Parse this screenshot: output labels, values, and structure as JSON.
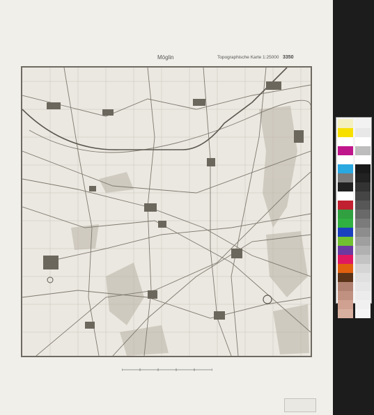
{
  "sheet": {
    "place_name": "Möglin",
    "map_type": "Topographische Karte 1:25000",
    "sheet_number": "3350"
  },
  "colors": {
    "paper": "#f0efea",
    "map_background": "#ebe8e1",
    "map_lines": "#8a857b",
    "frame": "#6e6a62"
  },
  "color_bar": {
    "left": [
      "#f5f0c0",
      "#f7e000",
      "#ffffff",
      "#c0168c",
      "#ffffff",
      "#2aa8e0",
      "#7a7a7a",
      "#202020",
      "#ffffff",
      "#c02030",
      "#30a040",
      "#30b040",
      "#1a40c0",
      "#70c030",
      "#6a3aa0",
      "#e01860",
      "#e06010",
      "#5a3318",
      "#b08070",
      "#c09080",
      "#d0a090",
      "#d8b0a0"
    ],
    "right": [
      "#f2f2f2",
      "#e8e8e8",
      "#ffffff",
      "#bdbdbd",
      "#ffffff",
      "#1a1a1a",
      "#222222",
      "#333333",
      "#454545",
      "#575757",
      "#696969",
      "#7b7b7b",
      "#8d8d8d",
      "#9f9f9f",
      "#b1b1b1",
      "#c3c3c3",
      "#d5d5d5",
      "#e0e0e0",
      "#e6e6e6",
      "#ececec",
      "#f0f0f0",
      "#f5f5f5"
    ]
  }
}
